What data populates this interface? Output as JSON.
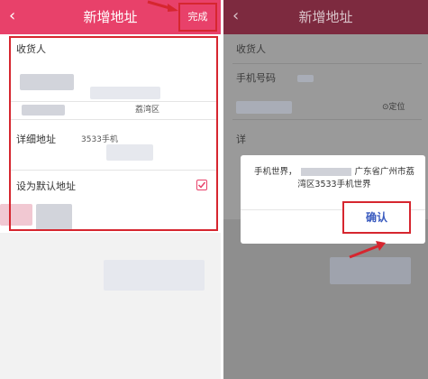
{
  "left": {
    "header": {
      "back": "‹",
      "title": "新增地址",
      "done": "完成"
    },
    "form": {
      "consignee_label": "收货人",
      "district_text": "荔湾区",
      "detail_label": "详细地址",
      "detail_value": "3533手机",
      "default_label": "设为默认地址"
    }
  },
  "right": {
    "header": {
      "back": "‹",
      "title": "新增地址"
    },
    "form": {
      "consignee_label": "收货人",
      "phone_label": "手机号码",
      "locate_label": "定位",
      "detail_label": "详"
    },
    "dialog": {
      "msg_start": "手机世界，",
      "msg_end": "广东省广州市荔湾区3533手机世界",
      "confirm": "确认"
    }
  },
  "colors": {
    "accent": "#e8416a",
    "highlight": "#d6262f",
    "confirm_text": "#3a5bbf"
  }
}
